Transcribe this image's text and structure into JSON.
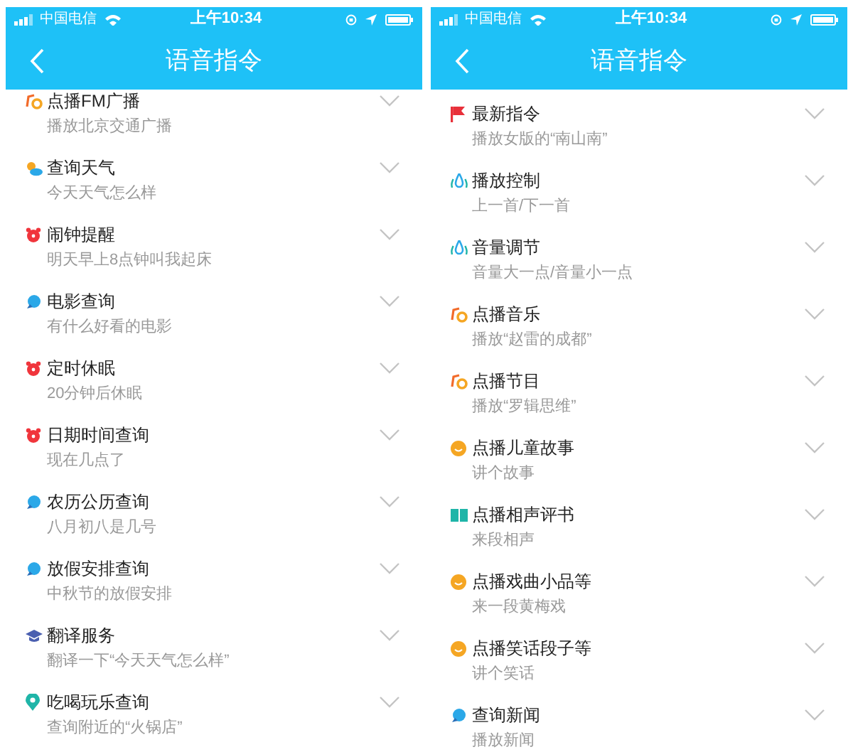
{
  "screens": [
    {
      "status_bar": {
        "carrier": "中国电信",
        "time": "上午10:34"
      },
      "nav_bar": {
        "title": "语音指令"
      },
      "commands": [
        {
          "kind": "music",
          "title": "点播FM广播",
          "example": "播放北京交通广播"
        },
        {
          "kind": "weather",
          "title": "查询天气",
          "example": "今天天气怎么样"
        },
        {
          "kind": "alarm",
          "title": "闹钟提醒",
          "example": "明天早上8点钟叫我起床"
        },
        {
          "kind": "chat",
          "title": "电影查询",
          "example": "有什么好看的电影"
        },
        {
          "kind": "alarm",
          "title": "定时休眠",
          "example": "20分钟后休眠"
        },
        {
          "kind": "alarm",
          "title": "日期时间查询",
          "example": "现在几点了"
        },
        {
          "kind": "chat",
          "title": "农历公历查询",
          "example": "八月初八是几号"
        },
        {
          "kind": "chat",
          "title": "放假安排查询",
          "example": "中秋节的放假安排"
        },
        {
          "kind": "cap",
          "title": "翻译服务",
          "example": "翻译一下“今天天气怎么样”"
        },
        {
          "kind": "pin",
          "title": "吃喝玩乐查询",
          "example": "查询附近的“火锅店”"
        }
      ]
    },
    {
      "status_bar": {
        "carrier": "中国电信",
        "time": "上午10:34"
      },
      "nav_bar": {
        "title": "语音指令"
      },
      "commands": [
        {
          "kind": "flag",
          "title": "最新指令",
          "example": "播放女版的“南山南”"
        },
        {
          "kind": "drops",
          "title": "播放控制",
          "example": "上一首/下一首"
        },
        {
          "kind": "drops",
          "title": "音量调节",
          "example": "音量大一点/音量小一点"
        },
        {
          "kind": "music",
          "title": "点播音乐",
          "example": "播放“赵雷的成都”"
        },
        {
          "kind": "music",
          "title": "点播节目",
          "example": "播放“罗辑思维”"
        },
        {
          "kind": "smile",
          "title": "点播儿童故事",
          "example": "讲个故事"
        },
        {
          "kind": "book",
          "title": "点播相声评书",
          "example": "来段相声"
        },
        {
          "kind": "smile",
          "title": "点播戏曲小品等",
          "example": "来一段黄梅戏"
        },
        {
          "kind": "smile",
          "title": "点播笑话段子等",
          "example": "讲个笑话"
        },
        {
          "kind": "chat",
          "title": "查询新闻",
          "example": "播放新闻"
        }
      ]
    }
  ]
}
